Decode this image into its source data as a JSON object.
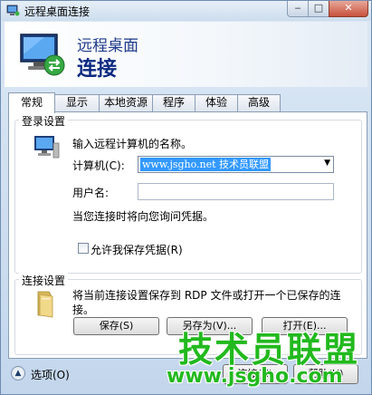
{
  "window": {
    "title": "远程桌面连接",
    "minimize_glyph": "‒",
    "maximize_glyph": "□",
    "close_glyph": "✕"
  },
  "banner": {
    "line1": "远程桌面",
    "line2": "连接",
    "icon": "remote-desktop-icon"
  },
  "tabs": [
    {
      "label": "常规",
      "active": true
    },
    {
      "label": "显示",
      "active": false
    },
    {
      "label": "本地资源",
      "active": false
    },
    {
      "label": "程序",
      "active": false
    },
    {
      "label": "体验",
      "active": false
    },
    {
      "label": "高级",
      "active": false
    }
  ],
  "login": {
    "legend": "登录设置",
    "prompt": "输入远程计算机的名称。",
    "computer_label": "计算机(C):",
    "computer_value": "www.jsgho.net 技术员联盟",
    "username_label": "用户名:",
    "username_value": "",
    "ask_text": "当您连接时将向您询问凭据。",
    "save_credentials_label": "允许我保存凭据(R)",
    "save_credentials_checked": false
  },
  "connection": {
    "legend": "连接设置",
    "description": "将当前连接设置保存到 RDP 文件或打开一个已保存的连接。",
    "save_label": "保存(S)",
    "save_as_label": "另存为(V)...",
    "open_label": "打开(E)..."
  },
  "footer": {
    "options_label": "选项(O)",
    "options_glyph": "▲",
    "connect_label": "连接(N)",
    "help_label": "帮助(H)"
  },
  "watermark": {
    "line1": "技术员联盟",
    "line2": "www.jsgho.com"
  },
  "colors": {
    "selection": "#3399ff",
    "banner_text": "#1e3a8a",
    "watermark": "#22b91e"
  }
}
